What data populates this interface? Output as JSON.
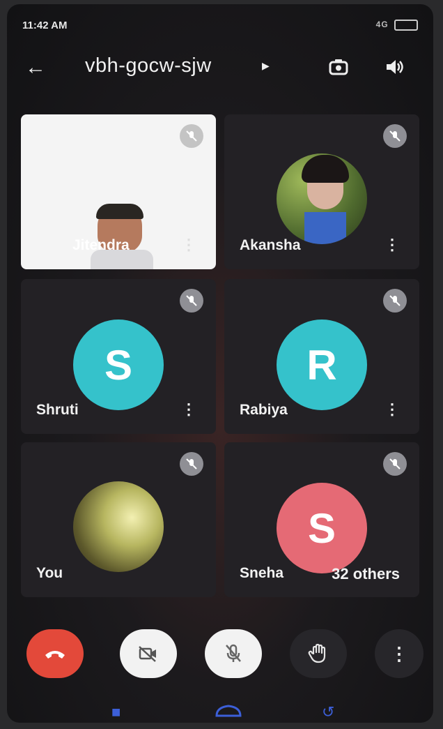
{
  "status": {
    "time": "11:42 AM",
    "network": "4G"
  },
  "header": {
    "meeting_code": "vbh-gocw-sjw"
  },
  "tiles": [
    {
      "name": "Jitendra",
      "type": "video"
    },
    {
      "name": "Akansha",
      "type": "photo"
    },
    {
      "name": "Shruti",
      "initial": "S",
      "color": "#35c2cb"
    },
    {
      "name": "Rabiya",
      "initial": "R",
      "color": "#35c2cb"
    },
    {
      "name": "You",
      "type": "photo"
    },
    {
      "name": "Sneha",
      "initial": "S",
      "color": "#e56a75",
      "others": "32 others"
    }
  ],
  "colors": {
    "end_call": "#e3493a",
    "control_light": "#f2f2f2",
    "control_dark": "#27262a"
  },
  "icons": [
    "back-arrow-icon",
    "switch-camera-icon",
    "speaker-icon",
    "mic-off-icon",
    "end-call-icon",
    "camera-off-icon",
    "raise-hand-icon",
    "more-vert-icon"
  ]
}
